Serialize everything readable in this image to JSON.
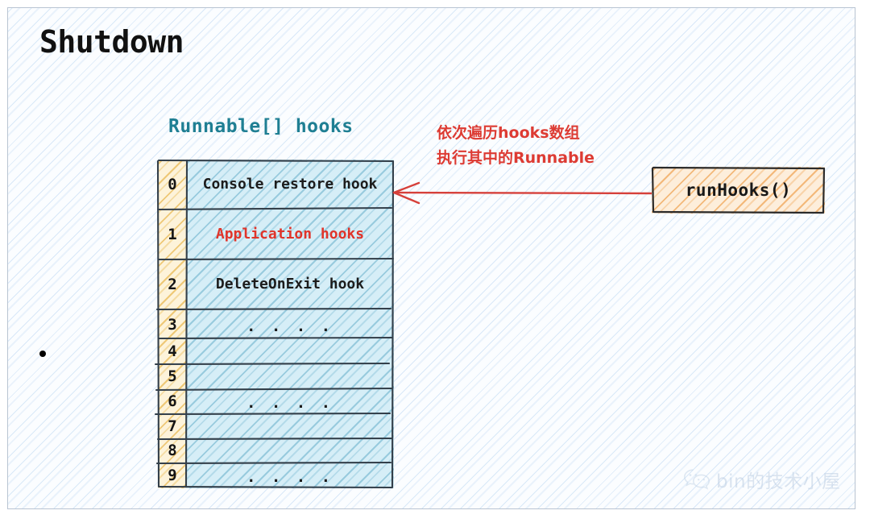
{
  "slide": {
    "title": "Shutdown",
    "bullet": "•"
  },
  "array": {
    "caption": "Runnable[] hooks",
    "rows": [
      {
        "index": "0",
        "value": "Console restore hook",
        "style": "normal"
      },
      {
        "index": "1",
        "value": "Application hooks",
        "style": "red"
      },
      {
        "index": "2",
        "value": "DeleteOnExit hook",
        "style": "normal"
      },
      {
        "index": "3",
        "value": ". . . .",
        "style": "dots"
      },
      {
        "index": "4",
        "value": "",
        "style": "normal"
      },
      {
        "index": "5",
        "value": "",
        "style": "normal"
      },
      {
        "index": "6",
        "value": ". . . .",
        "style": "dots"
      },
      {
        "index": "7",
        "value": "",
        "style": "normal"
      },
      {
        "index": "8",
        "value": "",
        "style": "normal"
      },
      {
        "index": "9",
        "value": ". . . .",
        "style": "dots"
      }
    ]
  },
  "annotation": {
    "line1": "依次遍历hooks数组",
    "line2": "执行其中的Runnable"
  },
  "runhooks": {
    "label": "runHooks()"
  },
  "watermark": {
    "text": "bin的技术小屋",
    "icon": "wechat-icon"
  },
  "colors": {
    "title": "#111111",
    "caption_teal": "#1f7f93",
    "annotation_red": "#dd3b33",
    "row_red": "#e0342a",
    "array_index_fill": "#fdf3da",
    "array_body_fill": "#d6eef7",
    "runhooks_fill": "#fdeedb",
    "arrow": "#d6403a",
    "background": "#fbfdff"
  }
}
